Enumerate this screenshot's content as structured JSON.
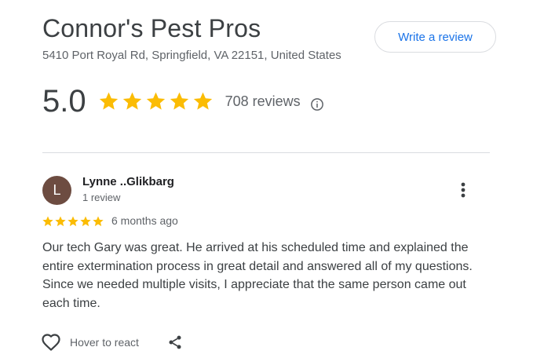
{
  "business": {
    "name": "Connor's Pest Pros",
    "address": "5410 Port Royal Rd, Springfield, VA 22151, United States",
    "write_review_label": "Write a review"
  },
  "summary": {
    "rating": "5.0",
    "stars_filled": 5,
    "reviews_count_label": "708 reviews",
    "star_color": "#fbbc04"
  },
  "icons": {
    "info": "info-circle-icon",
    "more": "more-vert-icon",
    "heart": "heart-outline-icon",
    "share": "share-icon"
  },
  "review": {
    "avatar_initial": "L",
    "avatar_color": "#6d4c41",
    "author": "Lynne ..Glikbarg",
    "author_review_count": "1 review",
    "stars_filled": 5,
    "date": "6 months ago",
    "text": "Our tech Gary was great. He arrived at his scheduled time and explained the entire extermination process in great detail and answered all of my questions. Since we needed multiple visits, I appreciate that the same person came out each time.",
    "react_label": "Hover to react"
  },
  "colors": {
    "accent": "#1a73e8",
    "divider": "#dadce0"
  }
}
